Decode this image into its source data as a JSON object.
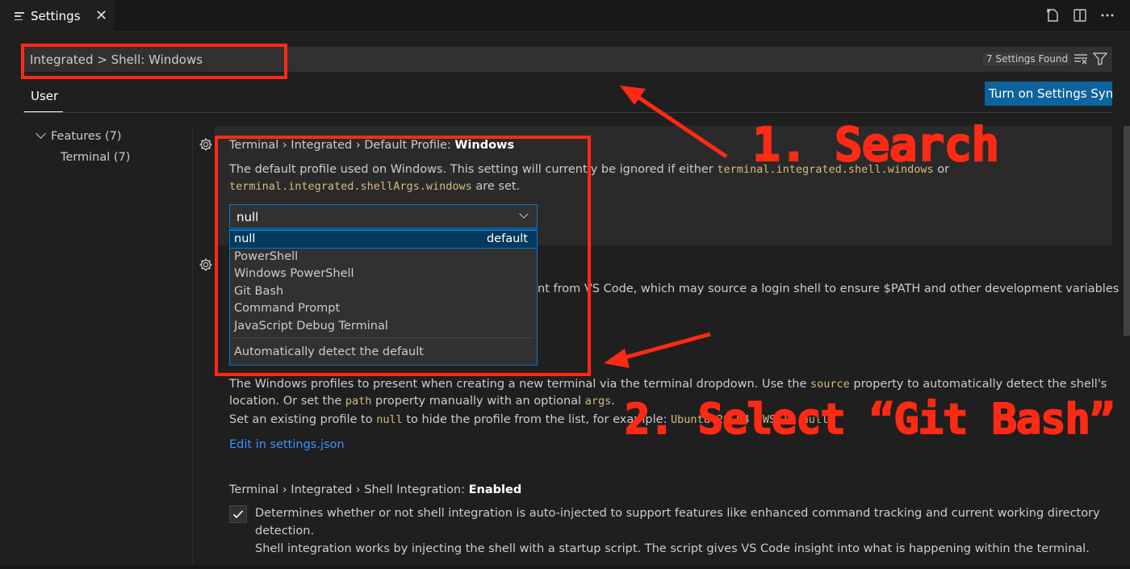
{
  "tab": {
    "label": "Settings",
    "close": "✕"
  },
  "search": {
    "value": "Integrated > Shell: Windows",
    "results": "7 Settings Found"
  },
  "scope": {
    "user_tab": "User",
    "sync_button": "Turn on Settings Sync"
  },
  "toc": [
    {
      "label": "Features (7)"
    },
    {
      "label": "Terminal (7)"
    }
  ],
  "setting1": {
    "title_prefix": "Terminal › Integrated › Default Profile: ",
    "title_bold": "Windows",
    "desc_1": "The default profile used on Windows. This setting will currently be ignored if either ",
    "code_1": "terminal.integrated.shell.windows",
    "desc_2": " or",
    "code_2": "terminal.integrated.shellArgs.windows",
    "desc_3": " are set.",
    "select_value": "null",
    "options": [
      {
        "label": "null",
        "tag": "default"
      },
      {
        "label": "PowerShell"
      },
      {
        "label": "Windows PowerShell"
      },
      {
        "label": "Git Bash"
      },
      {
        "label": "Command Prompt"
      },
      {
        "label": "JavaScript Debug Terminal"
      }
    ],
    "auto_detect": "Automatically detect the default"
  },
  "setting2": {
    "desc_visible": "nt from VS Code, which may source a login shell to ensure $PATH and other development variables"
  },
  "setting3": {
    "desc_1a": "The Windows profiles to present when creating a new terminal via the terminal dropdown. Use the ",
    "code_source": "source",
    "desc_1b": " property to automatically detect the shell's",
    "desc_2a": "location. Or set the ",
    "code_path": "path",
    "desc_2b": " property manually with an optional ",
    "code_args": "args",
    "desc_2c": ".",
    "desc_3a": "Set an existing profile to ",
    "code_null": "null",
    "desc_3b": " to hide the profile from the list, for example: ",
    "code_example": "Ubuntu-20.04 (WSL): null",
    "edit_link": "Edit in settings.json"
  },
  "setting4": {
    "title_prefix": "Terminal › Integrated › Shell Integration: ",
    "title_bold": "Enabled",
    "desc_1": "Determines whether or not shell integration is auto-injected to support features like enhanced command tracking and current working directory",
    "desc_2": "detection.",
    "desc_3": "Shell integration works by injecting the shell with a startup script. The script gives VS Code insight into what is happening within the terminal."
  },
  "annotations": {
    "step1": "1. Search",
    "step2": "2. Select “Git Bash”"
  },
  "colors": {
    "annotation": "#ff2a14",
    "accent": "#0078d4",
    "button": "#0e639c",
    "code": "#d7ba7d",
    "link": "#3794ff"
  }
}
